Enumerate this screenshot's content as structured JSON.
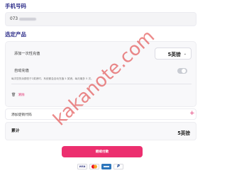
{
  "phone": {
    "title": "手机号码",
    "value_prefix": "073"
  },
  "product": {
    "title": "选定产品",
    "one_time_label": "添加一次性充值",
    "amount": "5英镑",
    "auto_recharge_label": "自动充值",
    "auto_recharge_on": false,
    "hint": "每次您的余额低于2英镑时，系统都会自动充值 5 英镑。每月最多 5 次。",
    "clear_label": "清除"
  },
  "promo": {
    "label": "添加促销代码",
    "add_symbol": "+"
  },
  "total": {
    "label": "累计",
    "value": "5英镑"
  },
  "pay_button_label": "继续付款",
  "payment_methods": [
    "VISA",
    "Mastercard",
    "American Express",
    "PayPal"
  ],
  "payment_text": {
    "visa": "VISA",
    "paypal": "P"
  },
  "watermark": "kakanote.com",
  "colors": {
    "accent": "#ec2f6f",
    "heading": "#2e2e8a",
    "watermark": "#dc2828"
  }
}
